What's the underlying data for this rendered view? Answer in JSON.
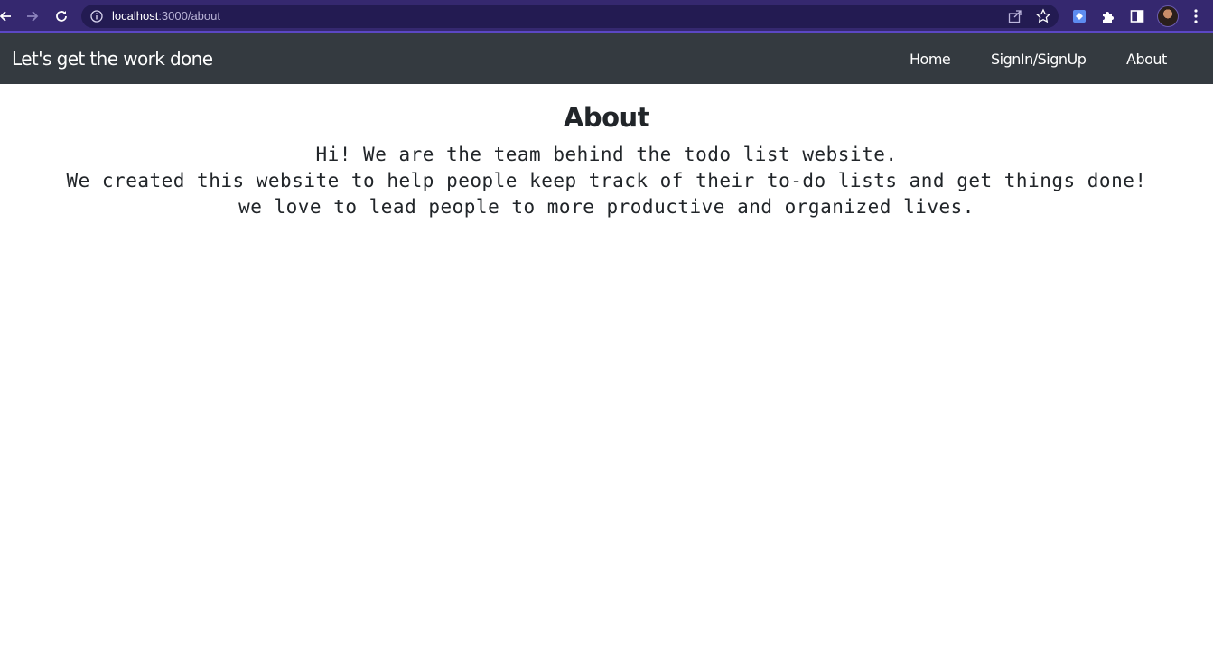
{
  "browser": {
    "url_host": "localhost",
    "url_path": ":3000/about",
    "icons": [
      "back-icon",
      "forward-icon",
      "reload-icon",
      "info-icon",
      "share-icon",
      "star-icon",
      "extension-icon",
      "puzzle-icon",
      "side-panel-icon",
      "avatar",
      "kebab-menu-icon"
    ]
  },
  "navbar": {
    "brand": "Let's get the work done",
    "links": [
      {
        "label": "Home"
      },
      {
        "label": "SignIn/SignUp"
      },
      {
        "label": "About"
      }
    ],
    "background": "#343a40"
  },
  "main": {
    "title": "About",
    "lines": [
      "Hi! We are the team behind the todo list website.",
      "We created this website to help people keep track of their to-do lists and get things done!",
      "we love to lead people to more productive and organized lives."
    ]
  },
  "colors": {
    "chrome": "#35286f",
    "text": "#212529"
  }
}
